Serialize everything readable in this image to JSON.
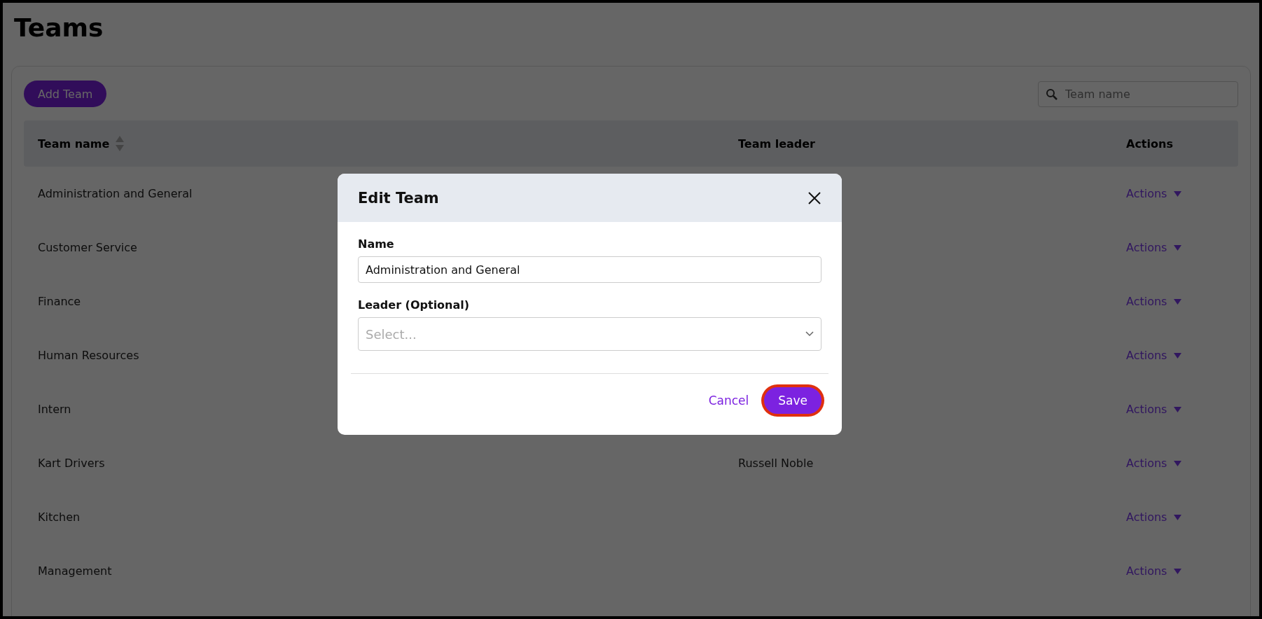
{
  "page": {
    "title": "Teams"
  },
  "toolbar": {
    "add_button": "Add Team",
    "search": {
      "placeholder": "Team name"
    }
  },
  "table": {
    "columns": [
      "Team name",
      "Team leader",
      "Actions"
    ],
    "rows": [
      {
        "name": "Administration and General",
        "leader": "",
        "action": "Actions"
      },
      {
        "name": "Customer Service",
        "leader": "",
        "action": "Actions"
      },
      {
        "name": "Finance",
        "leader": "",
        "action": "Actions"
      },
      {
        "name": "Human Resources",
        "leader": "",
        "action": "Actions"
      },
      {
        "name": "Intern",
        "leader": "",
        "action": "Actions"
      },
      {
        "name": "Kart Drivers",
        "leader": "Russell Noble",
        "action": "Actions"
      },
      {
        "name": "Kitchen",
        "leader": "",
        "action": "Actions"
      },
      {
        "name": "Management",
        "leader": "",
        "action": "Actions"
      }
    ]
  },
  "dialog": {
    "title": "Edit Team",
    "fields": [
      {
        "kind": "text",
        "label": "Name",
        "value": "Administration and General"
      },
      {
        "kind": "select",
        "label": "Leader (Optional)",
        "placeholder": "Select..."
      }
    ],
    "cancel": "Cancel",
    "save": {
      "label": "Save",
      "focused": true
    }
  }
}
